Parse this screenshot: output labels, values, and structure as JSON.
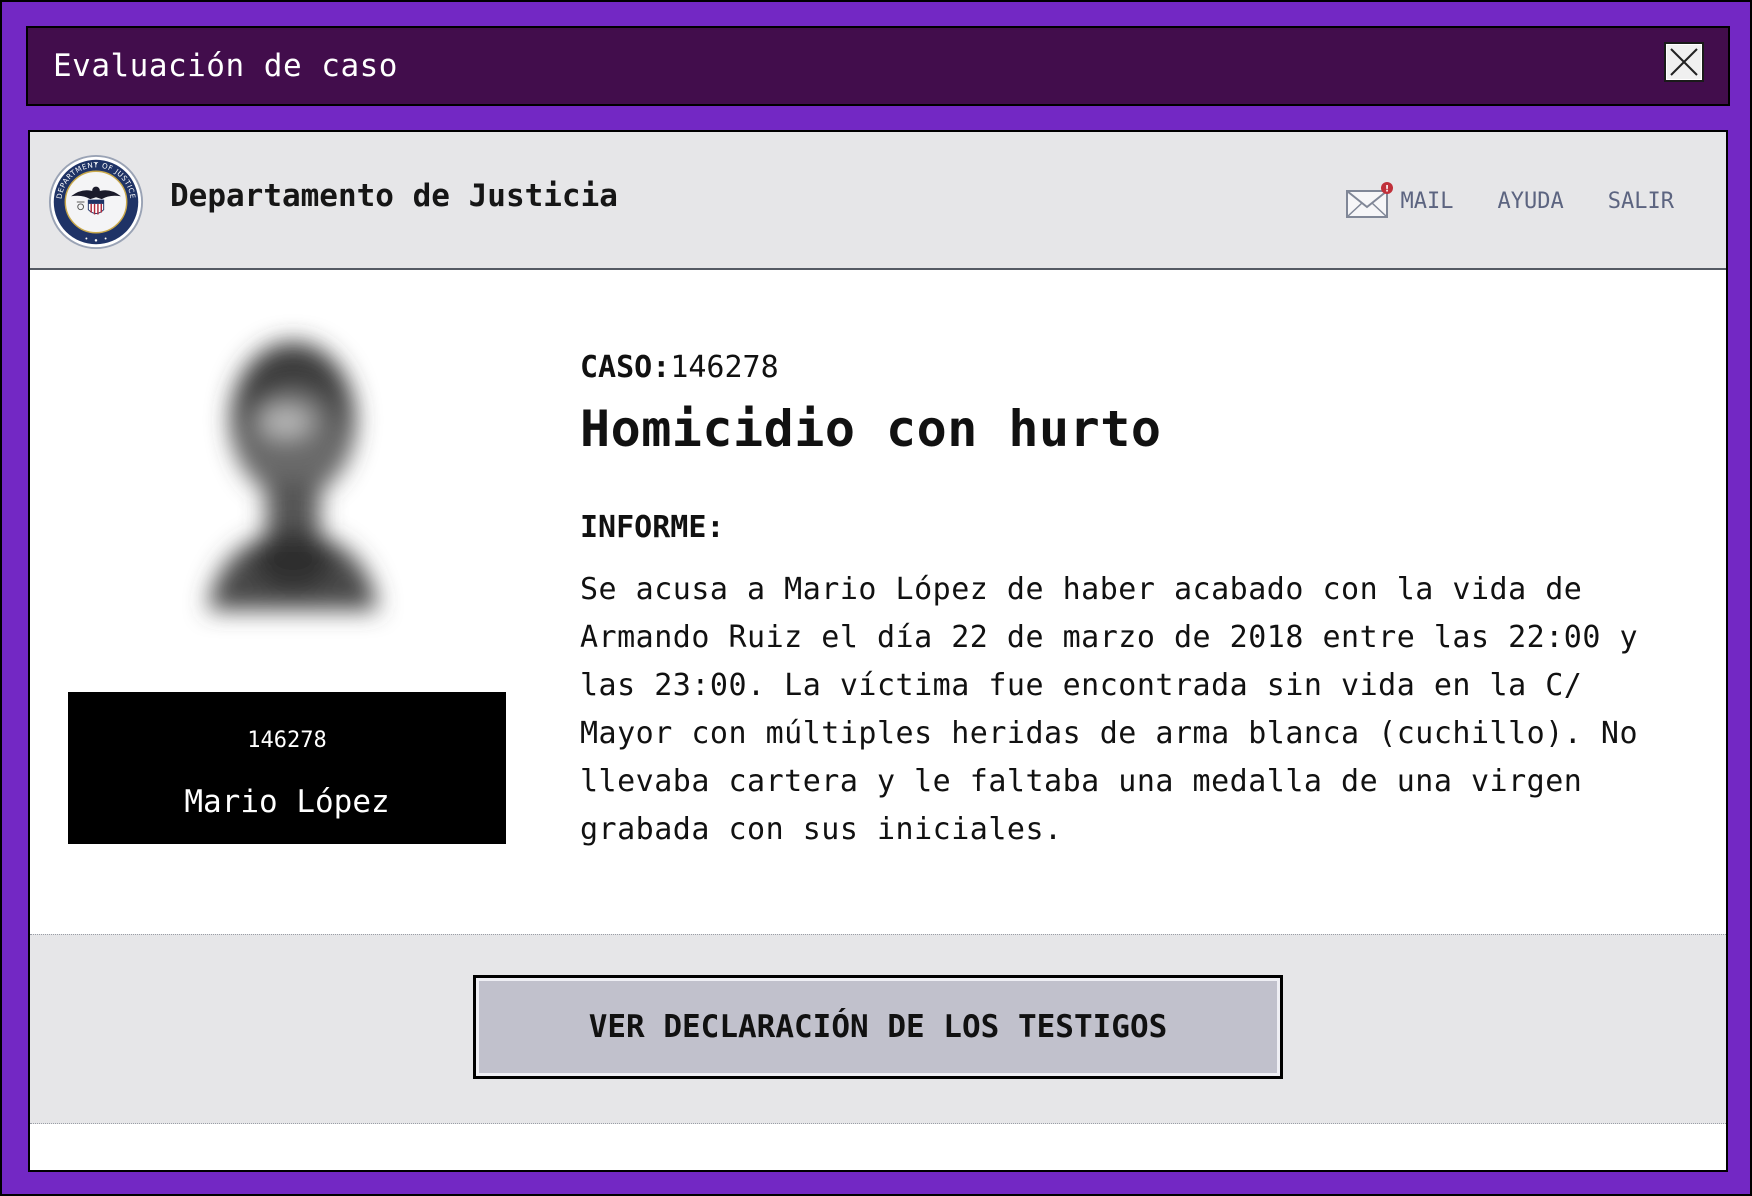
{
  "window": {
    "title": "Evaluación de caso"
  },
  "header": {
    "department": "Departamento de Justicia",
    "logo_text": "DEPARTMENT OF JUSTICE",
    "nav": {
      "mail": "MAIL",
      "help": "AYUDA",
      "logout": "SALIR"
    },
    "icons": {
      "mail": "envelope-icon",
      "notification": "notification-badge"
    }
  },
  "suspect": {
    "id": "146278",
    "name": "Mario López"
  },
  "case": {
    "label": "CASO:",
    "number": "146278",
    "title": "Homicidio con hurto",
    "report_label": "INFORME:",
    "report": "Se acusa a Mario López de haber acabado con la vida de Armando Ruiz el día 22 de marzo de 2018 entre las 22:00 y las 23:00. La víctima fue encontrada sin vida en la C/ Mayor con múltiples heridas de arma blanca (cuchillo). No llevaba cartera y le faltaba una medalla de una virgen grabada con sus iniciales."
  },
  "actions": {
    "witness_button": "VER DECLARACIÓN DE LOS TESTIGOS"
  },
  "colors": {
    "frame": "#7328c4",
    "titlebar": "#420d4c",
    "header_bg": "#e6e6e8",
    "nav_link": "#5c6480",
    "button_bg": "#c1c1cc",
    "notification": "#c0303a"
  }
}
